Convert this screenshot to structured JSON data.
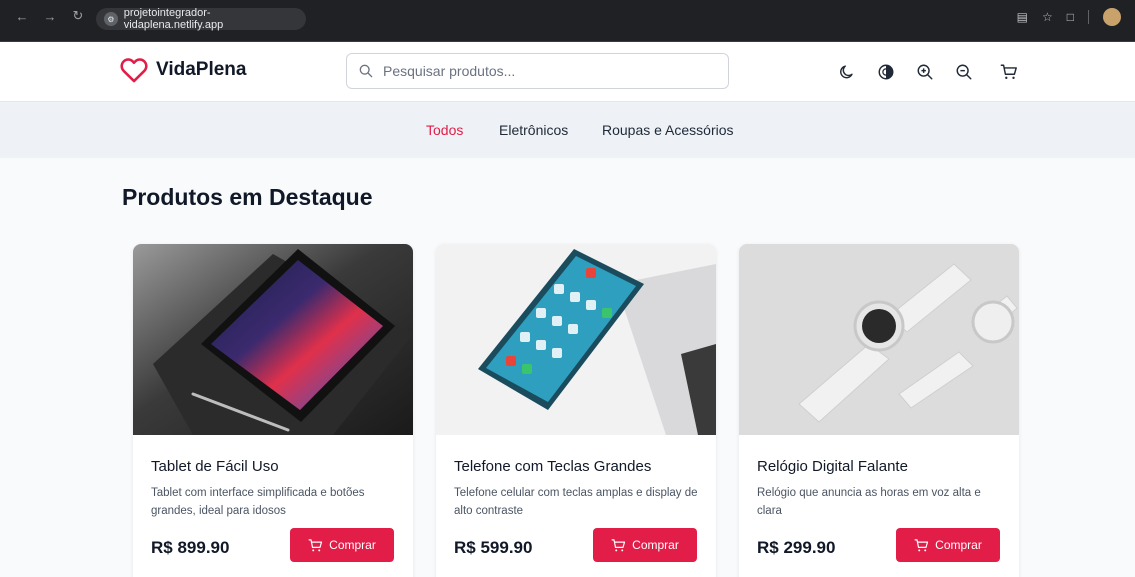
{
  "browser": {
    "url": "projetointegrador-vidaplena.netlify.app"
  },
  "header": {
    "logo_text": "VidaPlena",
    "search_placeholder": "Pesquisar produtos...",
    "icons": [
      "moon-icon",
      "contrast-icon",
      "zoom-in-icon",
      "zoom-out-icon",
      "cart-icon"
    ]
  },
  "categories": [
    {
      "label": "Todos",
      "active": true
    },
    {
      "label": "Eletrônicos",
      "active": false
    },
    {
      "label": "Roupas e Acessórios",
      "active": false
    }
  ],
  "main": {
    "section_title": "Produtos em Destaque",
    "products": [
      {
        "name": "Tablet de Fácil Uso",
        "description": "Tablet com interface simplificada e botões grandes, ideal para idosos",
        "price": "R$ 899.90",
        "button_label": "Comprar",
        "image": "tablet-photo"
      },
      {
        "name": "Telefone com Teclas Grandes",
        "description": "Telefone celular com teclas amplas e display de alto contraste",
        "price": "R$ 599.90",
        "button_label": "Comprar",
        "image": "phone-photo"
      },
      {
        "name": "Relógio Digital Falante",
        "description": "Relógio que anuncia as horas em voz alta e clara",
        "price": "R$ 299.90",
        "button_label": "Comprar",
        "image": "watch-photo"
      }
    ]
  },
  "colors": {
    "accent": "#e11d48",
    "header_bg": "#ffffff",
    "category_bar_bg": "#eef2f7",
    "page_bg": "#f8fafc"
  }
}
